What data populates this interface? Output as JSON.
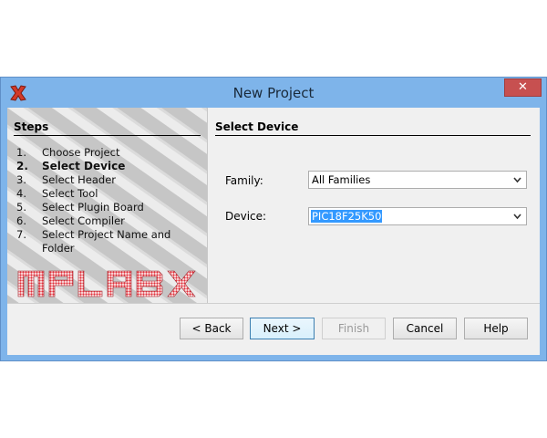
{
  "window": {
    "title": "New Project",
    "close_label": "✕"
  },
  "steps": {
    "heading": "Steps",
    "items": [
      {
        "num": "1.",
        "label": "Choose Project",
        "active": false
      },
      {
        "num": "2.",
        "label": "Select Device",
        "active": true
      },
      {
        "num": "3.",
        "label": "Select Header",
        "active": false
      },
      {
        "num": "4.",
        "label": "Select Tool",
        "active": false
      },
      {
        "num": "5.",
        "label": "Select Plugin Board",
        "active": false
      },
      {
        "num": "6.",
        "label": "Select Compiler",
        "active": false
      },
      {
        "num": "7.",
        "label": "Select Project Name and Folder",
        "active": false
      }
    ],
    "logo_text": "MPLABX",
    "logo_color": "#e0303a"
  },
  "content": {
    "heading": "Select Device",
    "family_label": "Family:",
    "family_value": "All Families",
    "device_label": "Device:",
    "device_value": "PIC18F25K50"
  },
  "buttons": {
    "back": "< Back",
    "next": "Next >",
    "finish": "Finish",
    "cancel": "Cancel",
    "help": "Help"
  },
  "colors": {
    "titlebar": "#7eb4ea",
    "close": "#c75050",
    "selection": "#3399ff"
  }
}
